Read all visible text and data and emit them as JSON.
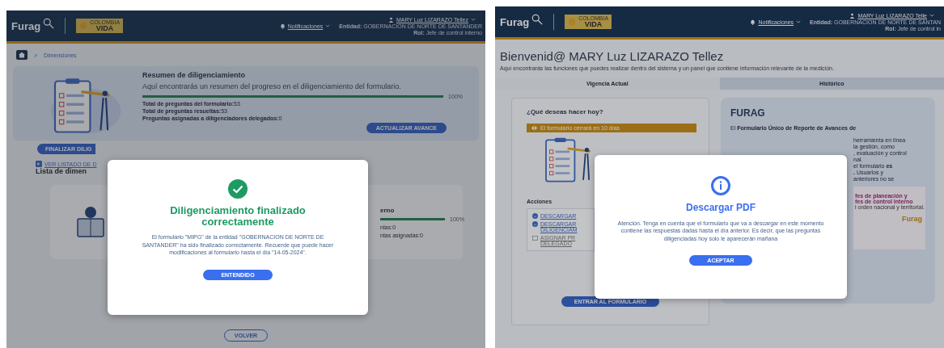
{
  "screens": [
    {
      "kind": "dimensions",
      "header": {
        "logo": "Furag",
        "brand_small": "COLOMBIA",
        "brand_big": "VIDA",
        "user": "MARY Luz LIZARAZO Tellez",
        "notifications": "Notificaciones",
        "entity_label": "Entidad:",
        "entity": "GOBERNACION DE NORTE DE SANTANDER",
        "role_label": "Rol:",
        "role": "Jefe de control interno"
      },
      "breadcrumb": {
        "separator": ">",
        "current": "Dimensiones"
      },
      "summary": {
        "title": "Resumen de diligenciamiento",
        "description": "Aquí encontrarás un resumen del progreso en el diligenciamiento del formulario.",
        "level": 1,
        "reading": "100%",
        "stats": [
          {
            "label": "Total de preguntas del formulario:",
            "value": "53"
          },
          {
            "label": "Total de preguntas resueltas:",
            "value": "53"
          },
          {
            "label": "Preguntas asignadas a diligenciadores delegados:",
            "value": "0"
          }
        ],
        "button": "ACTUALIZAR AVANCE"
      },
      "finish_button": "FINALIZAR DILIG",
      "list_link": "VER LISTADO DE D",
      "list_title": "Lista de dimen",
      "dimension_card": {
        "title": "erno",
        "level": 1,
        "reading": "100%",
        "lines": [
          "ntas:0",
          "ntas asignadas:0"
        ]
      },
      "back_button": "VOLVER",
      "modal": {
        "kind": "success",
        "title": "Diligenciamiento finalizado correctamente",
        "body": "El formulario \"MIPG\" de la entidad \"GOBERNACION DE NORTE DE SANTANDER\" ha sido finalizado correctamente. Recuerde que puede hacer modificaciones al formulario hasta el día \"14-05-2024\".",
        "button": "ENTENDIDO"
      }
    },
    {
      "kind": "home",
      "header": {
        "logo": "Furag",
        "brand_small": "COLOMBIA",
        "brand_big": "VIDA",
        "user": "MARY Luz LIZARAZO Telle",
        "notifications": "Notificaciones",
        "entity_label": "Entidad:",
        "entity": "GOBERNACION DE NORTE DE SANTAN",
        "role_label": "Rol:",
        "role": "Jefe de control in"
      },
      "title": "Bienvenid@ MARY Luz LIZARAZO Tellez",
      "subtitle": "Aquí encontrarás las funciones que puedes realizar dentro del sistema y un panel que contiene información relevante de la medición.",
      "tabs": [
        {
          "label": "Vigencia Actual",
          "selected": true
        },
        {
          "label": "Histórico",
          "selected": false
        }
      ],
      "actions_card": {
        "title": "¿Qué deseas hacer hoy?",
        "banner": "El formulario cerrará en 10 días",
        "actions_title": "Acciones",
        "actions": [
          {
            "label": "DESCARGAR",
            "disabled": false
          },
          {
            "label": "DESCARGAR DILIGENCIAM",
            "disabled": false
          },
          {
            "label": "ASIGNAR PR DELEGADO",
            "disabled": true
          }
        ],
        "button": "ENTRAR AL FORMULARIO"
      },
      "info_card": {
        "title": "FURAG",
        "intro": "El **Formulario Único de Reporte de Avances de**",
        "lines": [
          "herramienta en línea",
          "la gestión, como",
          ", evaluación y control",
          "nal.",
          "el formulario **es**",
          "**.** Usuarios y",
          "anteriores no se"
        ],
        "poster": {
          "lines": [
            "fes de planeación y",
            "fes de control interno",
            "l orden nacional y territorial."
          ],
          "logo": "Furag"
        }
      },
      "modal": {
        "kind": "info",
        "title": "Descargar PDF",
        "body": "Atención. Tenga en cuenta que el formulario que va a descargar en este momento contiene las respuestas dadas hasta el día anterior. Es decir, que las preguntas diligenciadas hoy solo le aparecerán mañana",
        "button": "ACEPTAR"
      }
    }
  ]
}
